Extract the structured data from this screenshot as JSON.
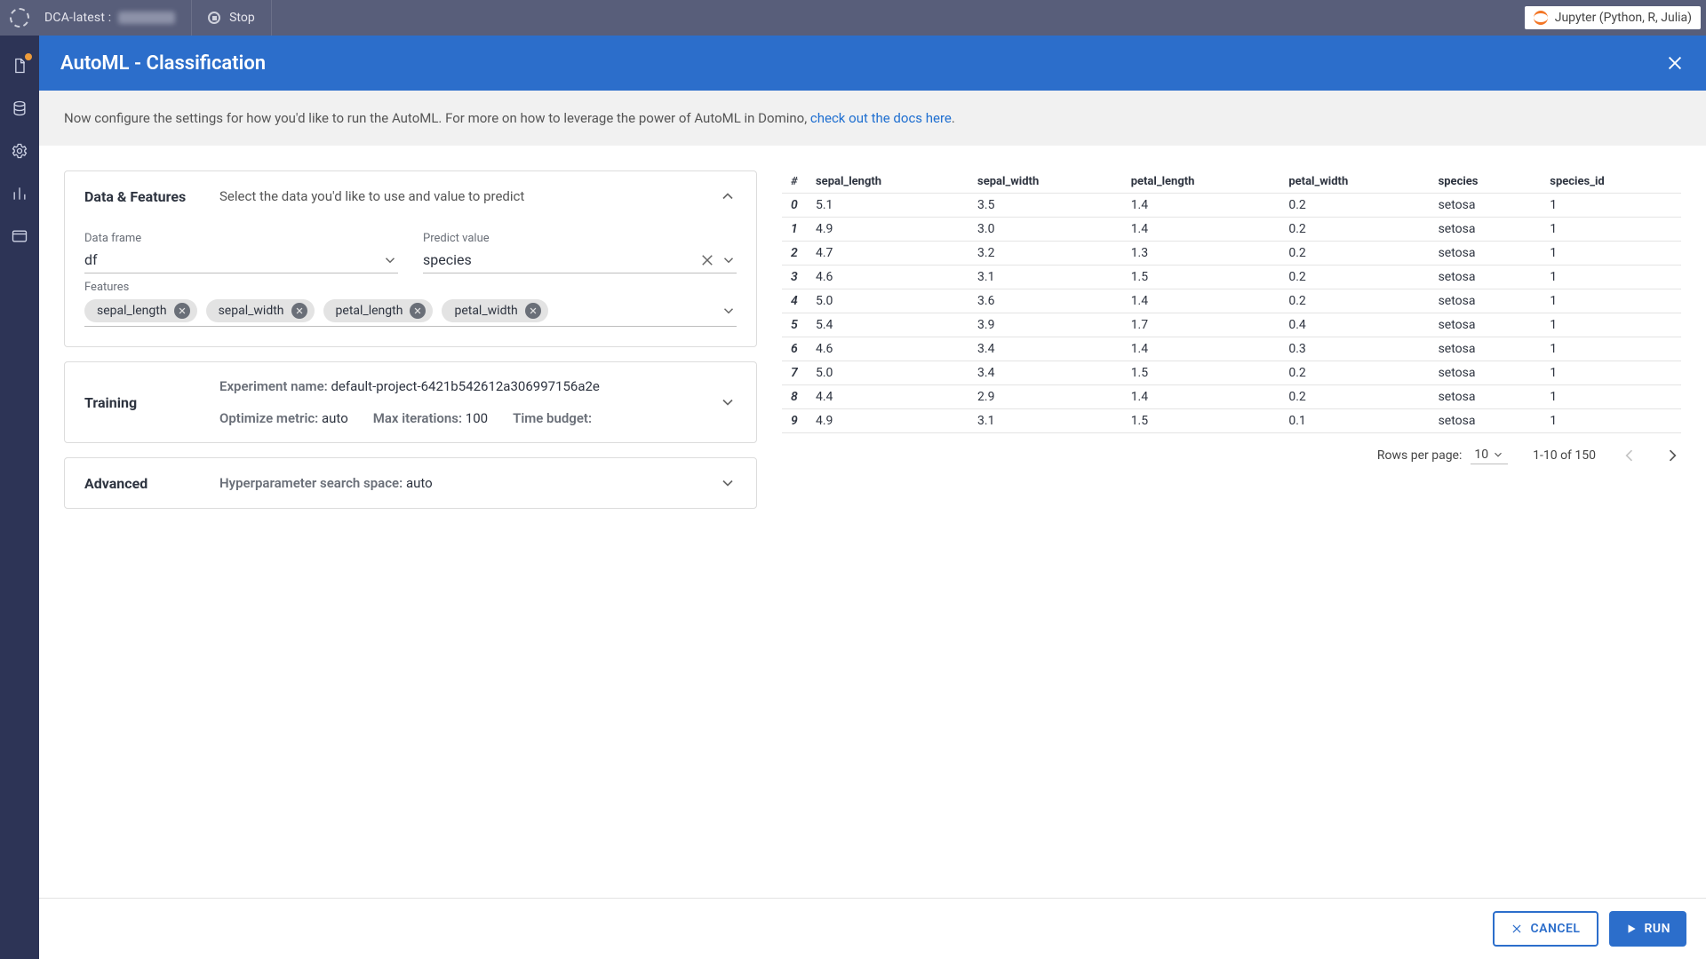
{
  "topbar": {
    "project_prefix": "DCA-latest :",
    "stop_label": "Stop",
    "jupyter_label": "Jupyter (Python, R, Julia)"
  },
  "header": {
    "title": "AutoML - Classification"
  },
  "info": {
    "text": "Now configure the settings for how you'd like to run the AutoML. For more on how to leverage the power of AutoML in Domino, ",
    "link_text": "check out the docs here",
    "suffix": "."
  },
  "panels": {
    "data": {
      "title": "Data & Features",
      "subtitle": "Select the data you'd like to use and value to predict",
      "dataframe_label": "Data frame",
      "dataframe_value": "df",
      "predict_label": "Predict value",
      "predict_value": "species",
      "features_label": "Features",
      "feature_chips": [
        "sepal_length",
        "sepal_width",
        "petal_length",
        "petal_width"
      ]
    },
    "training": {
      "title": "Training",
      "exp_name_label": "Experiment name:",
      "exp_name_value": "default-project-6421b542612a306997156a2e",
      "metric_label": "Optimize metric:",
      "metric_value": "auto",
      "iter_label": "Max iterations:",
      "iter_value": "100",
      "budget_label": "Time budget:",
      "budget_value": ""
    },
    "advanced": {
      "title": "Advanced",
      "hps_label": "Hyperparameter search space:",
      "hps_value": "auto"
    }
  },
  "table": {
    "columns": [
      "#",
      "sepal_length",
      "sepal_width",
      "petal_length",
      "petal_width",
      "species",
      "species_id"
    ],
    "rows": [
      [
        "0",
        "5.1",
        "3.5",
        "1.4",
        "0.2",
        "setosa",
        "1"
      ],
      [
        "1",
        "4.9",
        "3.0",
        "1.4",
        "0.2",
        "setosa",
        "1"
      ],
      [
        "2",
        "4.7",
        "3.2",
        "1.3",
        "0.2",
        "setosa",
        "1"
      ],
      [
        "3",
        "4.6",
        "3.1",
        "1.5",
        "0.2",
        "setosa",
        "1"
      ],
      [
        "4",
        "5.0",
        "3.6",
        "1.4",
        "0.2",
        "setosa",
        "1"
      ],
      [
        "5",
        "5.4",
        "3.9",
        "1.7",
        "0.4",
        "setosa",
        "1"
      ],
      [
        "6",
        "4.6",
        "3.4",
        "1.4",
        "0.3",
        "setosa",
        "1"
      ],
      [
        "7",
        "5.0",
        "3.4",
        "1.5",
        "0.2",
        "setosa",
        "1"
      ],
      [
        "8",
        "4.4",
        "2.9",
        "1.4",
        "0.2",
        "setosa",
        "1"
      ],
      [
        "9",
        "4.9",
        "3.1",
        "1.5",
        "0.1",
        "setosa",
        "1"
      ]
    ],
    "pager": {
      "rows_label": "Rows per page:",
      "rows_value": "10",
      "range": "1-10 of 150"
    }
  },
  "footer": {
    "cancel": "CANCEL",
    "run": "RUN"
  }
}
